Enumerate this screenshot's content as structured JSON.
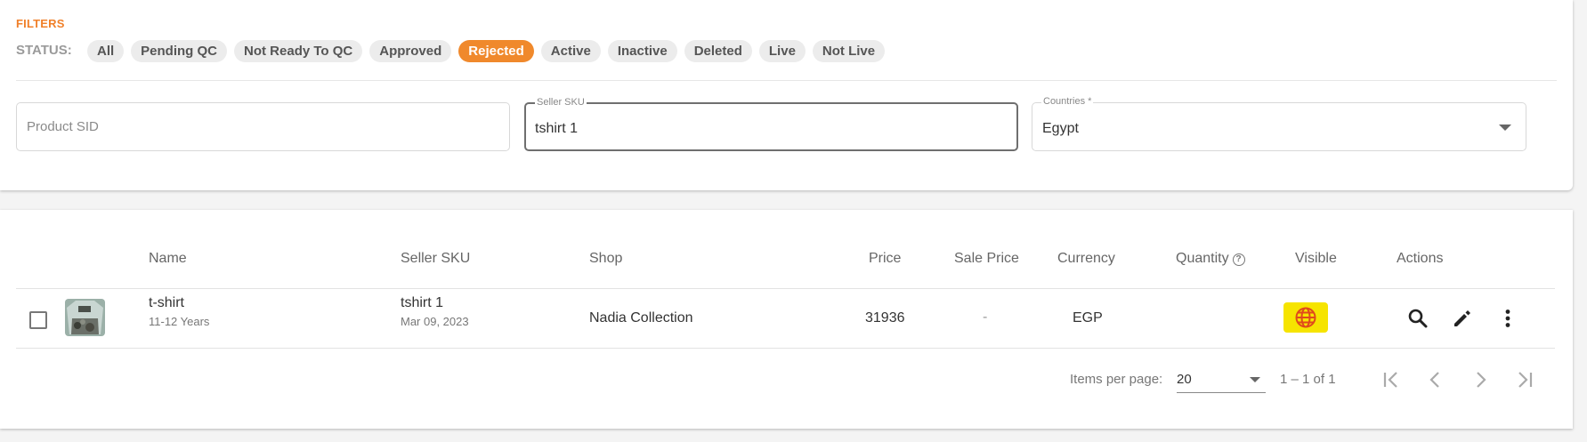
{
  "filters": {
    "title": "FILTERS",
    "status_label": "STATUS:",
    "chips": [
      {
        "label": "All",
        "active": false
      },
      {
        "label": "Pending QC",
        "active": false
      },
      {
        "label": "Not Ready To QC",
        "active": false
      },
      {
        "label": "Approved",
        "active": false
      },
      {
        "label": "Rejected",
        "active": true
      },
      {
        "label": "Active",
        "active": false
      },
      {
        "label": "Inactive",
        "active": false
      },
      {
        "label": "Deleted",
        "active": false
      },
      {
        "label": "Live",
        "active": false
      },
      {
        "label": "Not Live",
        "active": false
      }
    ],
    "product_sid": {
      "placeholder": "Product SID",
      "value": ""
    },
    "seller_sku": {
      "label": "Seller SKU",
      "value": "tshirt 1"
    },
    "countries": {
      "label": "Countries *",
      "value": "Egypt"
    }
  },
  "table": {
    "headers": {
      "name": "Name",
      "seller_sku": "Seller SKU",
      "shop": "Shop",
      "price": "Price",
      "sale_price": "Sale Price",
      "currency": "Currency",
      "quantity": "Quantity",
      "visible": "Visible",
      "actions": "Actions"
    },
    "rows": [
      {
        "name": "t-shirt",
        "name_sub": "11-12 Years",
        "seller_sku": "tshirt 1",
        "date": "Mar 09, 2023",
        "shop": "Nadia Collection",
        "price": "31936",
        "sale_price": "-",
        "currency": "EGP",
        "quantity": "",
        "visible_icon": "globe-icon",
        "actions": [
          "search-icon",
          "edit-icon",
          "more-vert-icon"
        ]
      }
    ]
  },
  "paginator": {
    "items_per_page_label": "Items per page:",
    "items_per_page": "20",
    "range": "1 – 1 of 1"
  },
  "colors": {
    "accent": "#f0892c",
    "visible_highlight": "#f6e400",
    "globe": "#e04a1c"
  }
}
